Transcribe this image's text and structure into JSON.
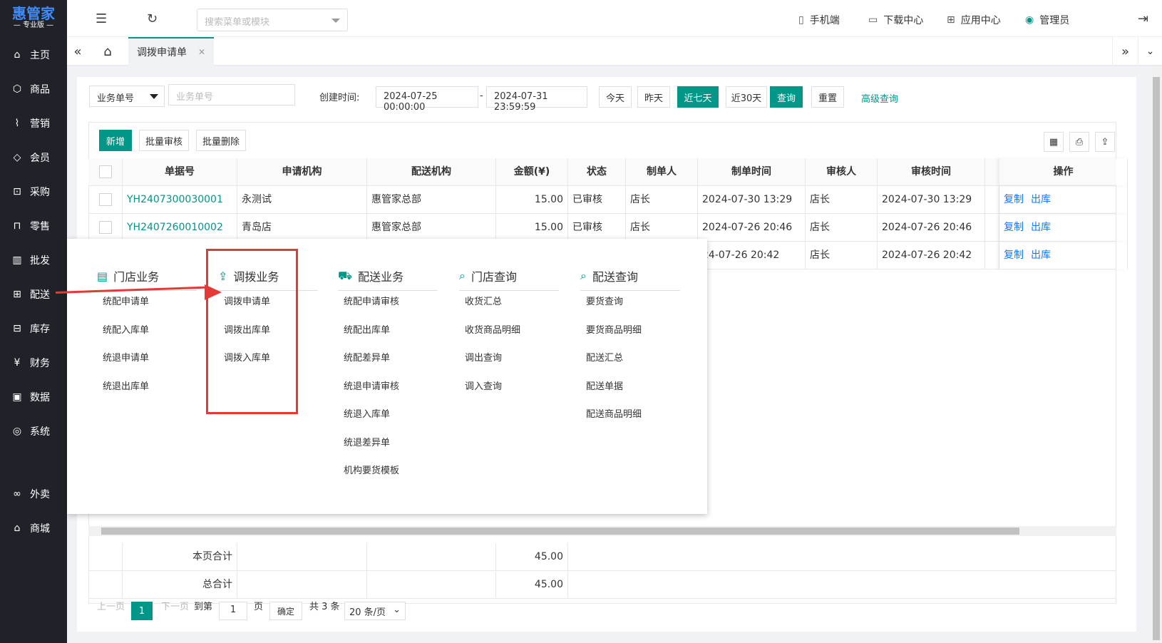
{
  "app": {
    "logo": "惠管家",
    "edition": "— 专业版 —"
  },
  "sidebar": {
    "items": [
      {
        "label": "主页",
        "icon": "home-icon",
        "glyph": "⌂"
      },
      {
        "label": "商品",
        "icon": "cube-icon",
        "glyph": "⬡"
      },
      {
        "label": "营销",
        "icon": "chart-icon",
        "glyph": "⌇"
      },
      {
        "label": "会员",
        "icon": "diamond-icon",
        "glyph": "◇"
      },
      {
        "label": "采购",
        "icon": "cart-icon",
        "glyph": "⊡"
      },
      {
        "label": "零售",
        "icon": "bag-icon",
        "glyph": "⊓"
      },
      {
        "label": "批发",
        "icon": "building-icon",
        "glyph": "▥"
      },
      {
        "label": "配送",
        "icon": "truck-icon",
        "glyph": "⊞"
      },
      {
        "label": "库存",
        "icon": "warehouse-icon",
        "glyph": "⊟"
      },
      {
        "label": "财务",
        "icon": "yen-icon",
        "glyph": "¥"
      },
      {
        "label": "数据",
        "icon": "data-icon",
        "glyph": "▣"
      },
      {
        "label": "系统",
        "icon": "settings-icon",
        "glyph": "◎"
      },
      {
        "label": "外卖",
        "icon": "bike-icon",
        "glyph": "∞"
      },
      {
        "label": "商城",
        "icon": "store-icon",
        "glyph": "⌂"
      }
    ]
  },
  "topbar": {
    "search_placeholder": "搜索菜单或模块",
    "mobile": "手机端",
    "download": "下载中心",
    "apps": "应用中心",
    "user": "管理员"
  },
  "tabs": {
    "active": "调拨申请单"
  },
  "filter": {
    "type": "业务单号",
    "doc_placeholder": "业务单号",
    "created_label": "创建时间:",
    "start": "2024-07-25 00:00:00",
    "sep": "-",
    "end": "2024-07-31 23:59:59",
    "today": "今天",
    "yesterday": "昨天",
    "last7": "近七天",
    "last30": "近30天",
    "query": "查询",
    "reset": "重置",
    "advanced": "高级查询"
  },
  "toolbar": {
    "new": "新增",
    "batch_audit": "批量审核",
    "batch_delete": "批量删除"
  },
  "table": {
    "headers": [
      "单据号",
      "申请机构",
      "配送机构",
      "金额(¥)",
      "状态",
      "制单人",
      "制单时间",
      "审核人",
      "审核时间",
      "操作"
    ],
    "rows": [
      {
        "doc": "YH2407300030001",
        "applicant": "永测试",
        "distributor": "惠管家总部",
        "amount": "15.00",
        "status": "已审核",
        "maker": "店长",
        "made_time": "2024-07-30 13:29",
        "auditor": "店长",
        "audit_time": "2024-07-30 13:29",
        "op1": "复制",
        "op2": "出库"
      },
      {
        "doc": "YH2407260010002",
        "applicant": "青岛店",
        "distributor": "惠管家总部",
        "amount": "15.00",
        "status": "已审核",
        "maker": "店长",
        "made_time": "2024-07-26 20:46",
        "auditor": "店长",
        "audit_time": "2024-07-26 20:46",
        "op1": "复制",
        "op2": "出库"
      },
      {
        "doc": "",
        "applicant": "",
        "distributor": "",
        "amount": "",
        "status": "",
        "maker": "",
        "made_time": "24-07-26 20:42",
        "auditor": "店长",
        "audit_time": "2024-07-26 20:42",
        "op1": "复制",
        "op2": "出库"
      }
    ],
    "page_total_label": "本页合计",
    "page_total": "45.00",
    "grand_total_label": "总合计",
    "grand_total": "45.00"
  },
  "pager": {
    "prev": "上一页",
    "current": "1",
    "next": "下一页",
    "goto": "到第",
    "page_input": "1",
    "page_unit": "页",
    "confirm": "确定",
    "total": "共 3 条",
    "size": "20 条/页"
  },
  "menu": {
    "columns": [
      {
        "title": "门店业务",
        "icon": "store-box-icon",
        "glyph": "▤",
        "items": [
          "统配申请单",
          "统配入库单",
          "统退申请单",
          "统退出库单"
        ]
      },
      {
        "title": "调拨业务",
        "icon": "transfer-icon",
        "glyph": "⇪",
        "items": [
          "调拨申请单",
          "调拨出库单",
          "调拨入库单"
        ]
      },
      {
        "title": "配送业务",
        "icon": "delivery-truck-icon",
        "glyph": "⛟",
        "items": [
          "统配申请审核",
          "统配出库单",
          "统配差异单",
          "统退申请审核",
          "统退入库单",
          "统退差异单",
          "机构要货模板"
        ]
      },
      {
        "title": "门店查询",
        "icon": "store-search-icon",
        "glyph": "⌕",
        "items": [
          "收货汇总",
          "收货商品明细",
          "调出查询",
          "调入查询"
        ]
      },
      {
        "title": "配送查询",
        "icon": "truck-search-icon",
        "glyph": "⌕",
        "items": [
          "要货查询",
          "要货商品明细",
          "配送汇总",
          "配送单据",
          "配送商品明细"
        ]
      }
    ]
  },
  "colors": {
    "sidebar": "#1f2329",
    "primary": "#009688",
    "link": "#1677ff",
    "highlight": "#e53935"
  }
}
